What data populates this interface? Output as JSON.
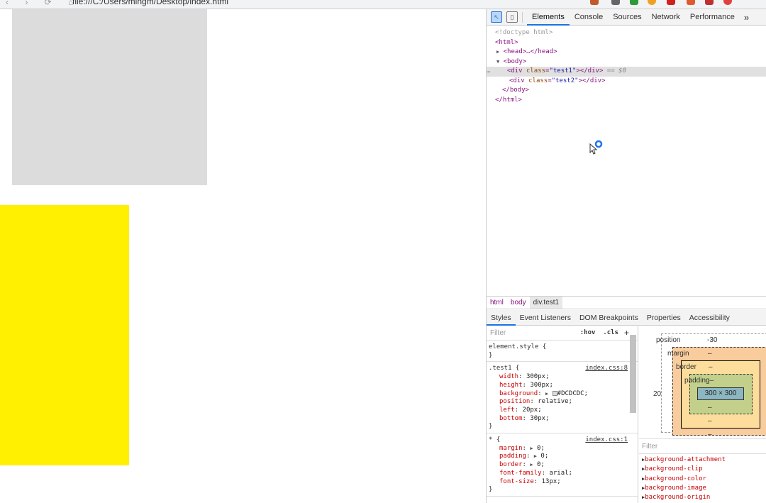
{
  "browser": {
    "nav_glyphs": "‹ › ⟳ ⌂",
    "url": "file:///C:/Users/mingm/Desktop/index.html"
  },
  "devtools": {
    "tabs": [
      "Elements",
      "Console",
      "Sources",
      "Network",
      "Performance"
    ],
    "active_tab": "Elements",
    "more_glyph": "»",
    "dom": {
      "doctype": "<!doctype html>",
      "html_open": "<html>",
      "head": "<head>…</head>",
      "body_open": "<body>",
      "div1_tag": "div",
      "div1_attr": "class",
      "div1_val": "\"test1\"",
      "div1_suffix": "== $0",
      "div2_tag": "div",
      "div2_attr": "class",
      "div2_val": "\"test2\"",
      "body_close": "</body>",
      "html_close": "</html>",
      "ellipsis": "…"
    },
    "breadcrumbs": [
      "html",
      "body",
      "div.test1"
    ],
    "sub_tabs": [
      "Styles",
      "Event Listeners",
      "DOM Breakpoints",
      "Properties",
      "Accessibility"
    ],
    "styles": {
      "filter_placeholder": "Filter",
      "hov": ":hov",
      "cls": ".cls",
      "plus": "+",
      "element_style": "element.style {",
      "close_brace": "}",
      "rule1_selector": ".test1 {",
      "rule1_source": "index.css:8",
      "rule1_props": [
        {
          "name": "width",
          "value": "300px;"
        },
        {
          "name": "height",
          "value": "300px;"
        },
        {
          "name": "background",
          "value": "#DCDCDC;"
        },
        {
          "name": "position",
          "value": "relative;"
        },
        {
          "name": "left",
          "value": "20px;"
        },
        {
          "name": "bottom",
          "value": "30px;"
        }
      ],
      "rule2_selector": "* {",
      "rule2_source": "index.css:1",
      "rule2_props": [
        {
          "name": "margin",
          "value": "0;"
        },
        {
          "name": "padding",
          "value": "0;"
        },
        {
          "name": "border",
          "value": "0;"
        },
        {
          "name": "font-family",
          "value": "arial;"
        },
        {
          "name": "font-size",
          "value": "13px;"
        }
      ]
    },
    "box_model": {
      "position_label": "position",
      "position_top": "-30",
      "margin_label": "margin",
      "margin_top": "–",
      "border_label": "border",
      "border_top": "–",
      "padding_label": "padding–",
      "content_size": "300 × 300",
      "left_value": "20",
      "dash": "–"
    },
    "computed_filter": "Filter",
    "computed_props": [
      "background-attachment",
      "background-clip",
      "background-color",
      "background-image",
      "background-origin"
    ]
  },
  "page": {
    "box1_color": "#DCDCDC",
    "box2_color": "#FFEF00"
  }
}
